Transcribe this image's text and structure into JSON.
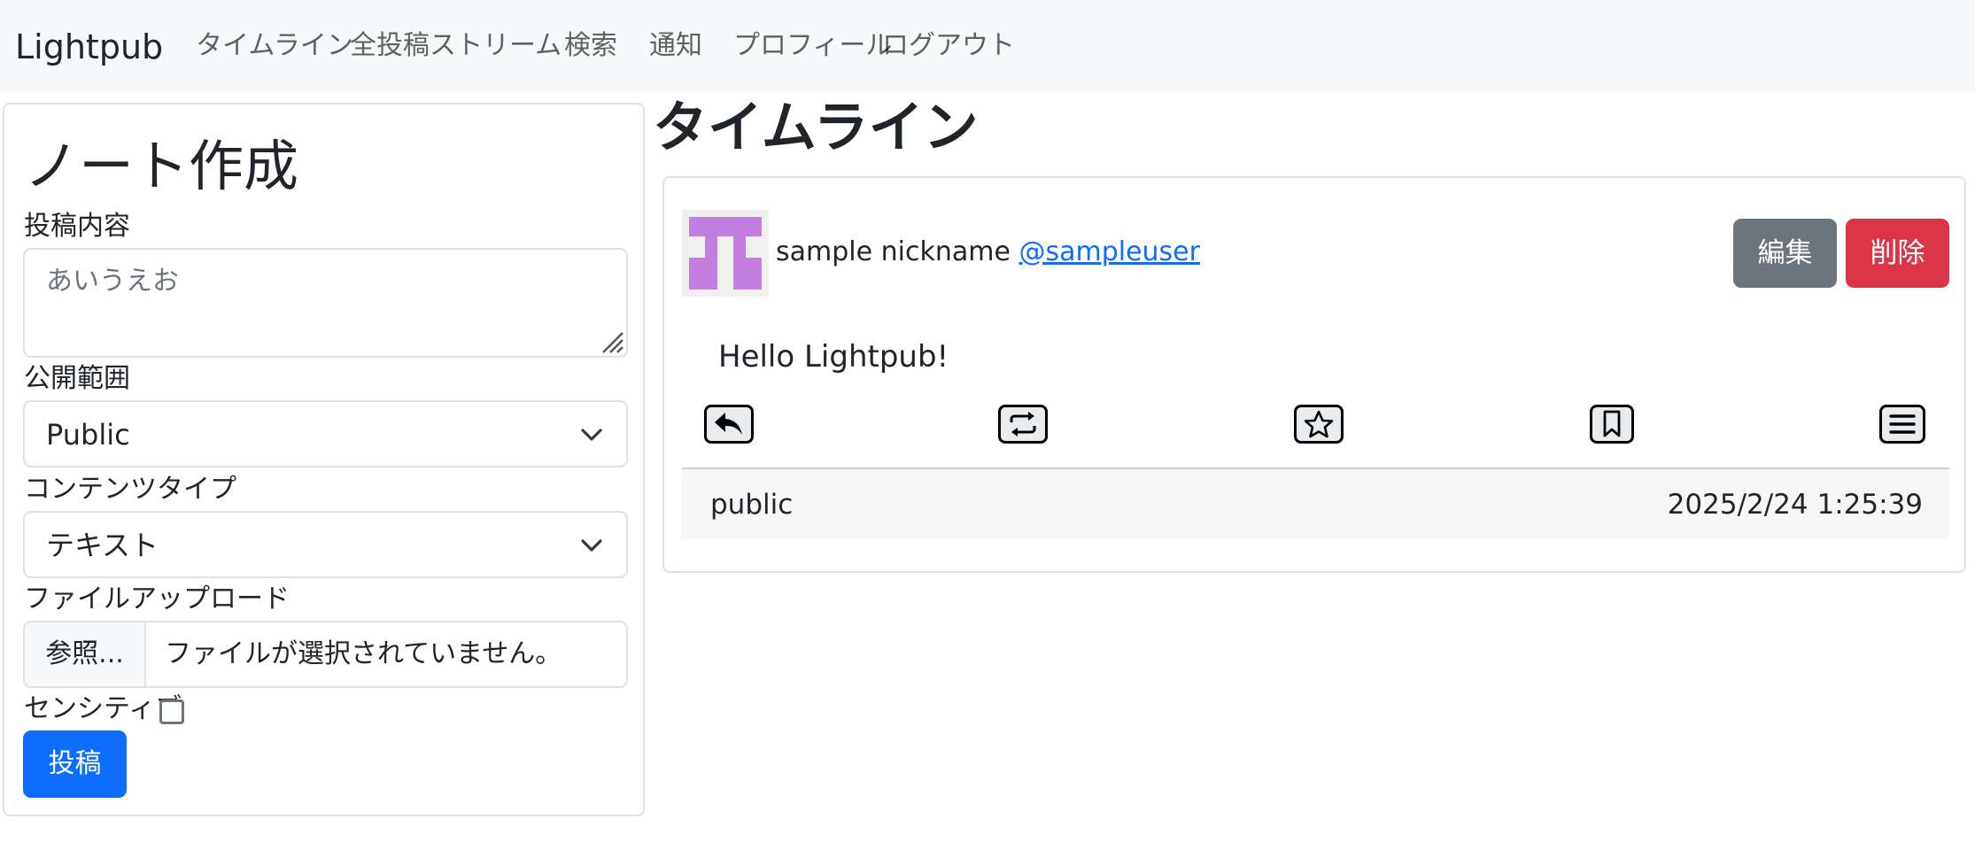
{
  "navbar": {
    "brand": "Lightpub",
    "links": [
      {
        "label": "タイムライン"
      },
      {
        "label": "全投稿ストリーム"
      },
      {
        "label": "検索"
      },
      {
        "label": "通知"
      },
      {
        "label": "プロフィール"
      },
      {
        "label": "ログアウト"
      }
    ]
  },
  "compose": {
    "title": "ノート作成",
    "content_label": "投稿内容",
    "content_value": "あいうえお",
    "visibility_label": "公開範囲",
    "visibility_value": "Public",
    "content_type_label": "コンテンツタイプ",
    "content_type_value": "テキスト",
    "upload_label": "ファイルアップロード",
    "upload_button": "参照...",
    "upload_status": "ファイルが選択されていません。",
    "sensitive_label": "センシティブ",
    "sensitive_checked": false,
    "submit_label": "投稿"
  },
  "timeline": {
    "title": "タイムライン",
    "posts": [
      {
        "nickname": "sample nickname",
        "username": "@sampleuser",
        "edit_label": "編集",
        "delete_label": "削除",
        "content": "Hello Lightpub!",
        "visibility": "public",
        "timestamp": "2025/2/24 1:25:39",
        "actions": [
          "reply-icon",
          "repost-icon",
          "favorite-icon",
          "bookmark-icon",
          "menu-icon"
        ]
      }
    ]
  },
  "colors": {
    "primary": "#0d6efd",
    "secondary": "#6c757d",
    "danger": "#dc3545",
    "avatar": "#c27fe0",
    "navbar_bg": "#f8f9fa"
  }
}
